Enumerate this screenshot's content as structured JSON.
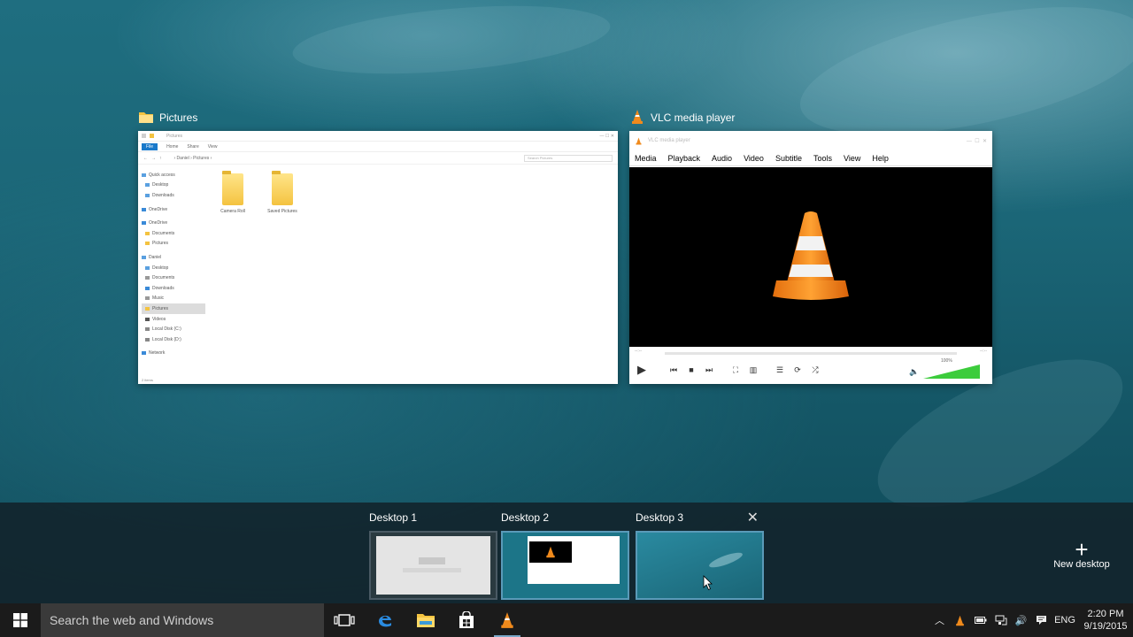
{
  "windows": [
    {
      "title": "Pictures",
      "icon": "folder-icon"
    },
    {
      "title": "VLC media player",
      "icon": "vlc-cone-icon"
    }
  ],
  "explorer": {
    "title": "Pictures",
    "ribbon_tabs": [
      "File",
      "Home",
      "Share",
      "View"
    ],
    "breadcrumb": "› Daniel › Pictures ›",
    "search_placeholder": "Search Pictures",
    "nav_items": [
      "Quick access",
      "Desktop",
      "Downloads",
      "OneDrive",
      "OneDrive",
      "Documents",
      "Pictures",
      "Daniel",
      "Desktop",
      "Documents",
      "Downloads",
      "Music",
      "Pictures",
      "Videos",
      "Local Disk (C:)",
      "Local Disk (D:)",
      "Network"
    ],
    "folders": [
      "Camera Roll",
      "Saved Pictures"
    ],
    "status": "2 items"
  },
  "vlc": {
    "title": "VLC media player",
    "menu": [
      "Media",
      "Playback",
      "Audio",
      "Video",
      "Subtitle",
      "Tools",
      "View",
      "Help"
    ],
    "time_left": "--:--",
    "time_right": "--:--",
    "volume": "100%"
  },
  "desktops": [
    {
      "label": "Desktop 1"
    },
    {
      "label": "Desktop 2"
    },
    {
      "label": "Desktop 3"
    }
  ],
  "new_desktop_label": "New desktop",
  "taskbar": {
    "search_placeholder": "Search the web and Windows",
    "lang": "ENG",
    "time": "2:20 PM",
    "date": "9/19/2015"
  },
  "colors": {
    "accent": "#1979ca",
    "vlc_orange": "#f08a1c",
    "volume_green": "#3ccc3c"
  }
}
